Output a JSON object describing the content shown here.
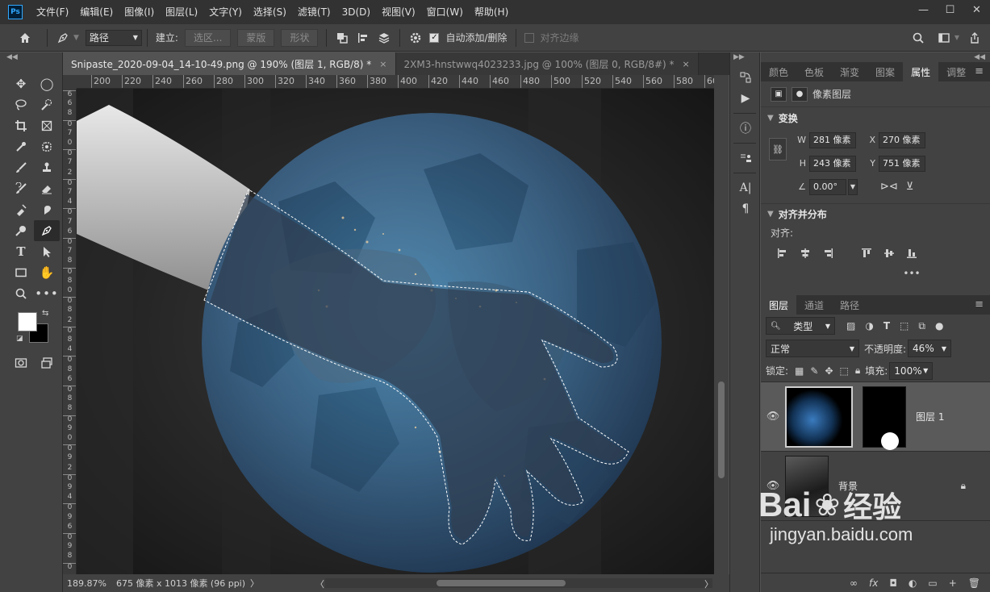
{
  "app": {
    "logo": "Ps"
  },
  "menu": [
    "文件(F)",
    "编辑(E)",
    "图像(I)",
    "图层(L)",
    "文字(Y)",
    "选择(S)",
    "滤镜(T)",
    "3D(D)",
    "视图(V)",
    "窗口(W)",
    "帮助(H)"
  ],
  "window_controls": {
    "minimize": "—",
    "maximize": "☐",
    "close": "✕"
  },
  "options": {
    "mode_select": "路径",
    "build_label": "建立:",
    "selection_btn": "选区...",
    "mask_btn": "蒙版",
    "shape_btn": "形状",
    "auto_add_label": "自动添加/删除",
    "auto_add_checked": "✓",
    "align_edges_label": "对齐边缘"
  },
  "tabs": [
    {
      "label": "Snipaste_2020-09-04_14-10-49.png @ 190% (图层 1, RGB/8) *",
      "close": "×"
    },
    {
      "label": "2XM3-hnstwwq4023233.jpg @ 100% (图层 0, RGB/8#) *",
      "close": "×"
    }
  ],
  "ruler_h": [
    "200",
    "220",
    "240",
    "260",
    "280",
    "300",
    "320",
    "340",
    "360",
    "380",
    "400",
    "420",
    "440",
    "460",
    "480",
    "500",
    "520",
    "540",
    "560",
    "580",
    "60"
  ],
  "ruler_v": [
    "6",
    "6",
    "8",
    "0",
    "7",
    "0",
    "0",
    "7",
    "2",
    "0",
    "7",
    "4",
    "0",
    "7",
    "6",
    "0",
    "7",
    "8",
    "0",
    "8",
    "0",
    "0",
    "8",
    "2",
    "0",
    "8",
    "4",
    "0",
    "8",
    "6",
    "0",
    "8",
    "8",
    "0",
    "9",
    "0",
    "0",
    "9",
    "2",
    "0",
    "9",
    "4",
    "0",
    "9",
    "6",
    "0",
    "9",
    "8",
    "0"
  ],
  "status": {
    "zoom": "189.87%",
    "doc_size": "675 像素 x 1013 像素 (96 ppi)",
    "arrow": "〉",
    "left_arrow": "〈",
    "right_arrow": "〉"
  },
  "properties_tabs": [
    "颜色",
    "色板",
    "渐变",
    "图案",
    "属性",
    "调整"
  ],
  "properties": {
    "header": "像素图层",
    "transform_title": "变换",
    "w_label": "W",
    "w_value": "281 像素",
    "h_label": "H",
    "h_value": "243 像素",
    "x_label": "X",
    "x_value": "270 像素",
    "y_label": "Y",
    "y_value": "751 像素",
    "angle_value": "0.00°",
    "align_title": "对齐并分布",
    "align_label": "对齐:",
    "more": "•••"
  },
  "layers_tabs": [
    "图层",
    "通道",
    "路径"
  ],
  "layers": {
    "filter_label": "类型",
    "blend_mode": "正常",
    "opacity_label": "不透明度:",
    "opacity_value": "46%",
    "lock_label": "锁定:",
    "fill_label": "填充:",
    "fill_value": "100%",
    "items": [
      {
        "name": "图层 1"
      },
      {
        "name": "背景"
      }
    ]
  },
  "layers_footer": [
    "∞",
    "fx",
    "◘",
    "◐",
    "▭",
    "+",
    "🗑"
  ],
  "watermark": {
    "brand": "Bai",
    "brand_cn": "经验",
    "url": "jingyan.baidu.com"
  },
  "colors": {
    "accent": "#31a8ff",
    "panel": "#424242",
    "dark": "#323232"
  }
}
